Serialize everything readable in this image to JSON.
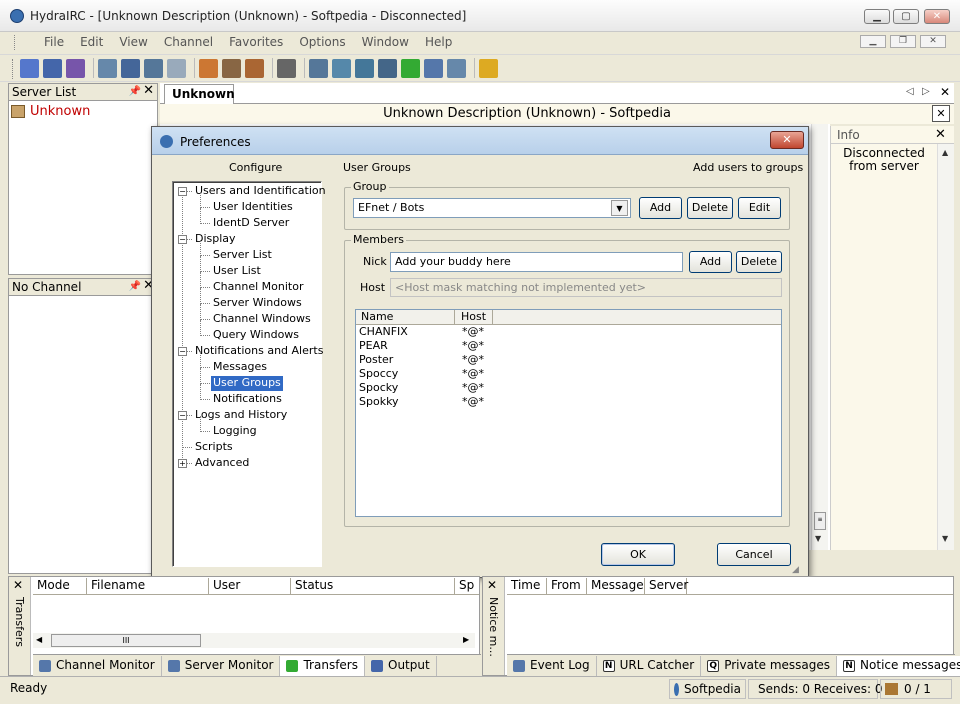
{
  "window": {
    "title": "HydraIRC - [Unknown Description (Unknown) - Softpedia - Disconnected]",
    "min": "▁",
    "max": "▢",
    "close": "✕"
  },
  "menu": [
    "File",
    "Edit",
    "View",
    "Channel",
    "Favorites",
    "Options",
    "Window",
    "Help"
  ],
  "mdi": {
    "min": "▁",
    "restore": "❐",
    "close": "✕"
  },
  "toolbar": {
    "icons": [
      "connect-icon",
      "disconnect-icon",
      "reconnect-icon",
      "sep",
      "cascade-icon",
      "tile-vertical-icon",
      "tile-horizontal-icon",
      "arrange-icon",
      "sep",
      "users-icon",
      "search-icon",
      "favorites-icon",
      "sep",
      "sound-icon",
      "sep",
      "server-list-icon",
      "channel-list-icon",
      "channel-monitor-icon",
      "server-monitor-icon",
      "transfers-icon",
      "notice-icon",
      "query-icon",
      "sep",
      "pen-icon"
    ],
    "colors": [
      "#5577cc",
      "#4466aa",
      "#7755aa",
      "",
      "#6688aa",
      "#446699",
      "#557799",
      "#99aabb",
      "",
      "#cc7733",
      "#886644",
      "#aa6633",
      "",
      "#666666",
      "",
      "#557799",
      "#5588aa",
      "#447799",
      "#446688",
      "#33aa33",
      "#5577aa",
      "#6688aa",
      "",
      "#ddaa22"
    ]
  },
  "server_list": {
    "title": "Server List",
    "items": [
      "Unknown"
    ],
    "pin": "📌",
    "close": "✕"
  },
  "no_channel": {
    "title": "No Channel",
    "pin": "📌",
    "close": "✕"
  },
  "doc_tab": {
    "label": "Unknown",
    "nav_left": "◁",
    "nav_right": "▷",
    "close": "✕"
  },
  "channel_header": "Unknown Description (Unknown) - Softpedia",
  "info_panel": {
    "title": "Info",
    "close": "✕",
    "text_line1": "Disconnected",
    "text_line2": "from server"
  },
  "prefs": {
    "title": "Preferences",
    "close": "✕",
    "configure_label": "Configure",
    "section_title": "User Groups",
    "section_hint": "Add users to groups",
    "tree": [
      {
        "label": "Users and Identification",
        "level": 0,
        "exp": "−"
      },
      {
        "label": "User Identities",
        "level": 1
      },
      {
        "label": "IdentD Server",
        "level": 1
      },
      {
        "label": "Display",
        "level": 0,
        "exp": "−"
      },
      {
        "label": "Server List",
        "level": 1
      },
      {
        "label": "User List",
        "level": 1
      },
      {
        "label": "Channel Monitor",
        "level": 1
      },
      {
        "label": "Server Windows",
        "level": 1
      },
      {
        "label": "Channel Windows",
        "level": 1
      },
      {
        "label": "Query Windows",
        "level": 1
      },
      {
        "label": "Notifications and Alerts",
        "level": 0,
        "exp": "−"
      },
      {
        "label": "Messages",
        "level": 1
      },
      {
        "label": "User Groups",
        "level": 1,
        "selected": true
      },
      {
        "label": "Notifications",
        "level": 1
      },
      {
        "label": "Logs and History",
        "level": 0,
        "exp": "−"
      },
      {
        "label": "Logging",
        "level": 1
      },
      {
        "label": "Scripts",
        "level": 0
      },
      {
        "label": "Advanced",
        "level": 0,
        "exp": "+"
      }
    ],
    "group": {
      "label": "Group",
      "selected": "EFnet / Bots",
      "add": "Add",
      "delete": "Delete",
      "edit": "Edit"
    },
    "members": {
      "label": "Members",
      "nick_label": "Nick",
      "nick_value": "Add your buddy here",
      "add": "Add",
      "delete": "Delete",
      "host_label": "Host",
      "host_value": "<Host mask matching not implemented yet>",
      "columns": [
        "Name",
        "Host"
      ],
      "rows": [
        [
          "CHANFIX",
          "*@*"
        ],
        [
          "PEAR",
          "*@*"
        ],
        [
          "Poster",
          "*@*"
        ],
        [
          "Spoccy",
          "*@*"
        ],
        [
          "Spocky",
          "*@*"
        ],
        [
          "Spokky",
          "*@*"
        ]
      ]
    },
    "ok": "OK",
    "cancel": "Cancel"
  },
  "transfers": {
    "columns": [
      "Mode",
      "Filename",
      "User",
      "Status",
      "Sp"
    ],
    "vertical_label": "Transfers",
    "scroll_thumb": "III",
    "tabs": [
      "Channel Monitor",
      "Server Monitor",
      "Transfers",
      "Output"
    ],
    "tab_colors": [
      "#5577aa",
      "#5577aa",
      "#33aa33",
      "#4466aa"
    ]
  },
  "notice": {
    "vertical_label": "Notice m...",
    "columns": [
      "Time",
      "From",
      "Message",
      "Server"
    ],
    "tabs": [
      {
        "ic": "",
        "label": "Event Log"
      },
      {
        "ic": "N",
        "label": "URL Catcher"
      },
      {
        "ic": "Q",
        "label": "Private messages"
      },
      {
        "ic": "N",
        "label": "Notice messages"
      }
    ]
  },
  "statusbar": {
    "ready": "Ready",
    "server": "Softpedia",
    "sends": "Sends: 0 Receives: 0",
    "count": "0 / 1"
  }
}
